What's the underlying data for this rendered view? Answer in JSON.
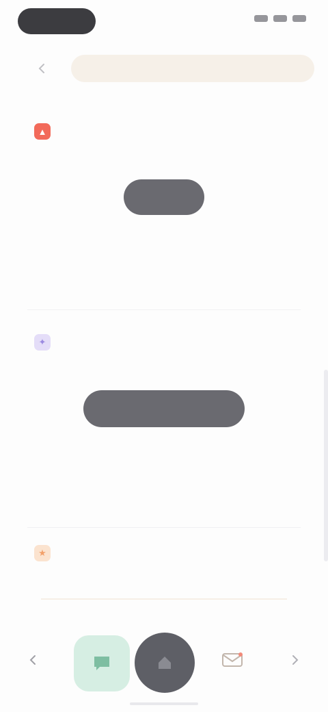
{
  "status_bar": {
    "time": "",
    "pill_color": "#3c3c40"
  },
  "search": {
    "placeholder": "",
    "back_icon": "chevron-left-icon",
    "bg_color": "#f6f0e8"
  },
  "sections": [
    {
      "icon": "flame-icon",
      "icon_color": "#f26a5a",
      "label": "",
      "empty_title": "",
      "empty_subtitle": "",
      "button_label": ""
    },
    {
      "icon": "sparkle-icon",
      "icon_color": "#b5a8e8",
      "label": "",
      "empty_title": "",
      "button_label": ""
    },
    {
      "icon": "star-icon",
      "icon_color": "#f2b07a",
      "label": "",
      "sublabel": ""
    }
  ],
  "bottom_nav": {
    "back_icon": "chevron-left-icon",
    "chat_icon": "chat-bubble-icon",
    "home_icon": "home-icon",
    "mail_icon": "mail-icon",
    "forward_icon": "chevron-right-icon",
    "chat_bg": "#d6eee3",
    "home_bg": "#5e5f66"
  },
  "colors": {
    "button": "#6a6a70",
    "background": "#fdfdfd"
  }
}
